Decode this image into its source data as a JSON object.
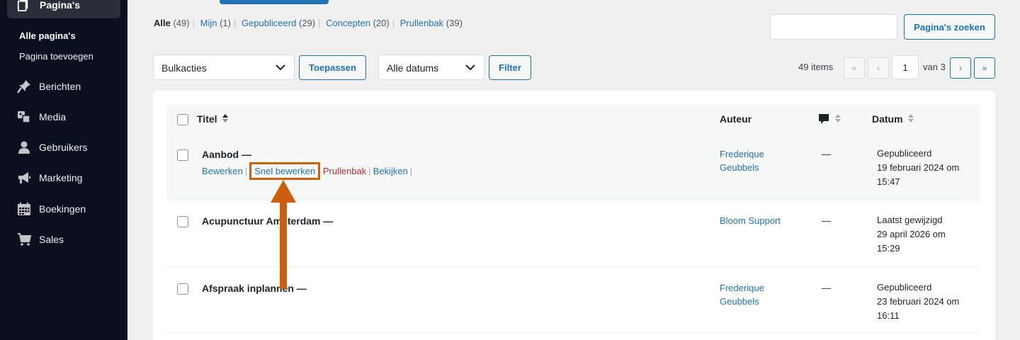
{
  "sidebar": {
    "current_menu": "Pagina's",
    "submenu": [
      "Alle pagina's",
      "Pagina toevoegen"
    ],
    "items": [
      {
        "label": "Berichten",
        "icon": "pin-icon"
      },
      {
        "label": "Media",
        "icon": "media-icon"
      },
      {
        "label": "Gebruikers",
        "icon": "user-icon"
      },
      {
        "label": "Marketing",
        "icon": "megaphone-icon"
      },
      {
        "label": "Boekingen",
        "icon": "calendar-icon"
      },
      {
        "label": "Sales",
        "icon": "cart-icon"
      }
    ]
  },
  "filters": {
    "all": {
      "label": "Alle",
      "count": "(49)"
    },
    "mine": {
      "label": "Mijn",
      "count": "(1)"
    },
    "published": {
      "label": "Gepubliceerd",
      "count": "(29)"
    },
    "drafts": {
      "label": "Concepten",
      "count": "(20)"
    },
    "trash": {
      "label": "Prullenbak",
      "count": "(39)"
    }
  },
  "search": {
    "button": "Pagina's zoeken",
    "value": ""
  },
  "toolbar": {
    "bulk_select": "Bulkacties",
    "apply": "Toepassen",
    "date_select": "Alle datums",
    "filter": "Filter"
  },
  "pagination": {
    "items": "49 items",
    "first": "«",
    "prev": "‹",
    "current": "1",
    "of": "van 3",
    "next": "›",
    "last": "»"
  },
  "table": {
    "headers": {
      "title": "Titel",
      "author": "Auteur",
      "date": "Datum"
    },
    "rows": [
      {
        "title": "Aanbod —",
        "author_line1": "Frederique",
        "author_line2": "Geubbels",
        "comments": "—",
        "status": "Gepubliceerd",
        "date_line1": "19 februari 2024 om",
        "date_line2": "15:47",
        "actions": {
          "edit": "Bewerken",
          "quick_edit": "Snel bewerken",
          "trash": "Prullenbak",
          "view": "Bekijken"
        }
      },
      {
        "title": "Acupunctuur Amsterdam —",
        "author_line1": "Bloom Support",
        "author_line2": "",
        "comments": "—",
        "status": "Laatst gewijzigd",
        "date_line1": "29 april 2026 om",
        "date_line2": "15:29"
      },
      {
        "title": "Afspraak inplannen —",
        "author_line1": "Frederique",
        "author_line2": "Geubbels",
        "comments": "—",
        "status": "Gepubliceerd",
        "date_line1": "23 februari 2024 om",
        "date_line2": "16:11"
      }
    ]
  },
  "colors": {
    "sidebar_bg": "#0c0f1f",
    "accent": "#2271b1",
    "trash": "#b32d2e",
    "highlight": "#cc5f0f"
  }
}
